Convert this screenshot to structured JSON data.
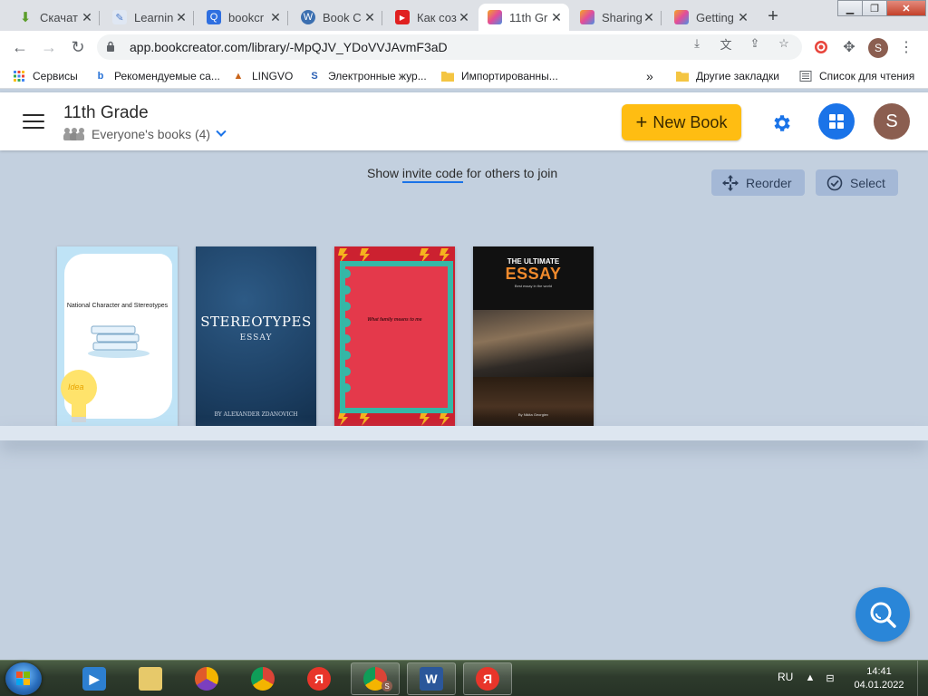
{
  "browser": {
    "tabs": [
      {
        "title": "Скачат",
        "favicon": "download-arrow-icon",
        "color": "#5b9d2a"
      },
      {
        "title": "Learnin",
        "favicon": "pencil-board-icon",
        "color": "#4a79c9"
      },
      {
        "title": "bookcr",
        "favicon": "search-q-icon",
        "color": "#2f6fe0"
      },
      {
        "title": "Book C",
        "favicon": "wordpress-icon",
        "color": "#3b6fb0"
      },
      {
        "title": "Как соз",
        "favicon": "youtube-icon",
        "color": "#e02020"
      },
      {
        "title": "11th Gr",
        "favicon": "bookcreator-icon",
        "color": "#e24c9b",
        "active": true
      },
      {
        "title": "Sharing",
        "favicon": "bookcreator-icon",
        "color": "#e24c9b"
      },
      {
        "title": "Getting",
        "favicon": "bookcreator-icon",
        "color": "#e24c9b"
      }
    ],
    "url": "app.bookcreator.com/library/-MpQJV_YDoVVJAvmF3aD",
    "profile_initial": "S",
    "bookmarks": [
      {
        "label": "Сервисы",
        "icon": "apps-grid-icon"
      },
      {
        "label": "Рекомендуемые са...",
        "icon": "bing-icon"
      },
      {
        "label": "LINGVO",
        "icon": "lingvo-icon"
      },
      {
        "label": "Электронные жур...",
        "icon": "s-logo-icon"
      },
      {
        "label": "Импортированны...",
        "icon": "folder-icon"
      },
      {
        "label": "Другие закладки",
        "icon": "folder-icon"
      },
      {
        "label": "Список для чтения",
        "icon": "reading-list-icon"
      }
    ],
    "overflow_label": "»"
  },
  "header": {
    "title": "11th Grade",
    "subtitle": "Everyone's books (4)",
    "new_book_label": "New Book",
    "new_book_plus": "+",
    "avatar_initial": "S",
    "accent": "#1a73e8",
    "new_book_color": "#ffbd12"
  },
  "invite": {
    "prefix": "Show ",
    "link": "invite code",
    "suffix": " for others to join"
  },
  "actions": {
    "reorder_label": "Reorder",
    "select_label": "Select"
  },
  "books": [
    {
      "title": "National Character and Stereotypes",
      "badge": "Idea"
    },
    {
      "title": "STEREOTYPES",
      "subtitle": "ESSAY",
      "author": "BY ALEXANDER ZDANOVICH"
    },
    {
      "title": "What family means to me"
    },
    {
      "title_line1": "THE ULTIMATE",
      "title_line2": "ESSAY",
      "tagline": "Best essay in the world",
      "author": "By Nikita Georgiev"
    }
  ],
  "taskbar": {
    "lang": "RU",
    "time": "14:41",
    "date": "04.01.2022",
    "chrome_badge": "S",
    "word_letter": "W",
    "yandex_letter": "Я"
  }
}
